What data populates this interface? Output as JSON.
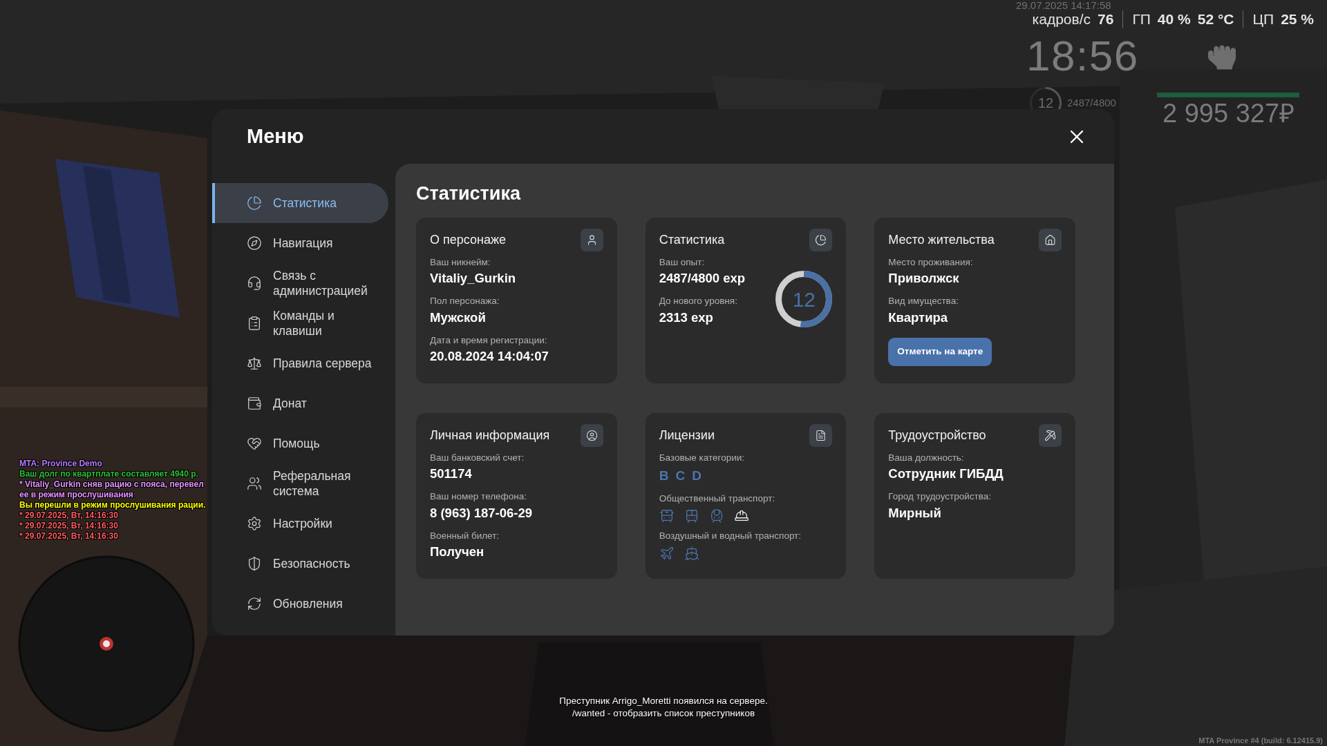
{
  "hud": {
    "datetime": "29.07.2025 14:17:58",
    "stats": [
      {
        "label": "кадров/с",
        "values": [
          "76"
        ]
      },
      {
        "label": "ГП",
        "values": [
          "40 %",
          "52 °C"
        ]
      },
      {
        "label": "ЦП",
        "values": [
          "25 %"
        ]
      }
    ],
    "clock": "18:56",
    "level_ring": {
      "text": "12",
      "level": 0.52
    },
    "exp": "2487/4800",
    "bar": {
      "level": 1
    },
    "money": "2 995 327₽"
  },
  "chat": [
    {
      "text": "MTA: Province Demo",
      "color": "#b57aff"
    },
    {
      "text": "Ваш долг по квартплате составляет 4940 р.",
      "color": "#2fbf3a"
    },
    {
      "text": "* Vitaliy_Gurkin сняв рацию с пояса, перевел ее в режим прослушивания",
      "color": "#e393ff"
    },
    {
      "text": "Вы перешли в режим прослушивания рации.",
      "color": "#ffff00"
    },
    {
      "text": "* 29.07.2025, Вт, 14:16:30",
      "color": "#ff5c5c"
    },
    {
      "text": "* 29.07.2025, Вт, 14:16:30",
      "color": "#ff5c5c"
    },
    {
      "text": "* 29.07.2025, Вт, 14:16:30",
      "color": "#ff5c5c"
    }
  ],
  "menu": {
    "title": "Меню",
    "sidebar": {
      "items": [
        {
          "label": "Статистика",
          "selected": true
        },
        {
          "label": "Навигация",
          "selected": false
        },
        {
          "label": "Связь с администрацией",
          "selected": false
        },
        {
          "label": "Команды и клавиши",
          "selected": false
        },
        {
          "label": "Правила сервера",
          "selected": false
        },
        {
          "label": "Донат",
          "selected": false
        },
        {
          "label": "Помощь",
          "selected": false
        },
        {
          "label": "Реферальная система",
          "selected": false
        },
        {
          "label": "Настройки",
          "selected": false
        },
        {
          "label": "Безопасность",
          "selected": false
        },
        {
          "label": "Обновления",
          "selected": false
        }
      ]
    },
    "content": {
      "title": "Статистика",
      "cards": [
        {
          "kind": "person",
          "title": "О персонаже",
          "fields": [
            {
              "label": "Ваш никнейм:",
              "value": "Vitaliy_Gurkin"
            },
            {
              "label": "Пол персонажа:",
              "value": "Мужской"
            },
            {
              "label": "Дата и время регистрации:",
              "value": "20.08.2024 14:04:07"
            }
          ]
        },
        {
          "kind": "stats",
          "title": "Статистика",
          "fields": [
            {
              "label": "Ваш опыт:",
              "value": "2487/4800 exp"
            },
            {
              "label": "До нового уровня:",
              "value": "2313 exp"
            }
          ],
          "ring": {
            "text": "12",
            "level": 0.52
          }
        },
        {
          "kind": "home",
          "title": "Место жительства",
          "fields": [
            {
              "label": "Место проживания:",
              "value": "Приволжск"
            },
            {
              "label": "Вид имущества:",
              "value": "Квартира"
            }
          ],
          "button": "Отметить на карте"
        },
        {
          "kind": "personal",
          "title": "Личная информация",
          "fields": [
            {
              "label": "Ваш банковский счет:",
              "value": "501174"
            },
            {
              "label": "Ваш номер телефона:",
              "value": "8 (963) 187-06-29"
            },
            {
              "label": "Военный билет:",
              "value": "Получен"
            }
          ]
        },
        {
          "kind": "licenses",
          "title": "Лицензии",
          "sections": [
            {
              "kind": "letters",
              "label": "Базовые категории:",
              "items": [
                "B",
                "C",
                "D"
              ]
            },
            {
              "kind": "icons",
              "label": "Общественный транспорт:",
              "icons": [
                {
                  "kind": "bus",
                  "active": true
                },
                {
                  "kind": "tram",
                  "active": true
                },
                {
                  "kind": "train",
                  "active": true
                },
                {
                  "kind": "cap",
                  "active": false
                }
              ]
            },
            {
              "kind": "icons",
              "label": "Воздушный и водный транспорт:",
              "icons": [
                {
                  "kind": "plane",
                  "active": true
                },
                {
                  "kind": "ship",
                  "active": true
                }
              ]
            }
          ]
        },
        {
          "kind": "job",
          "title": "Трудоустройство",
          "fields": [
            {
              "label": "Ваша должность:",
              "value": "Сотрудник ГИБДД"
            },
            {
              "label": "Город трудоустройства:",
              "value": "Мирный"
            }
          ]
        }
      ]
    }
  },
  "notice": [
    "Преступник Arrigo_Moretti появился на сервере.",
    "/wanted - отобразить список преступников"
  ],
  "build": "MTA Province #4 (build: 6.12415.9)"
}
